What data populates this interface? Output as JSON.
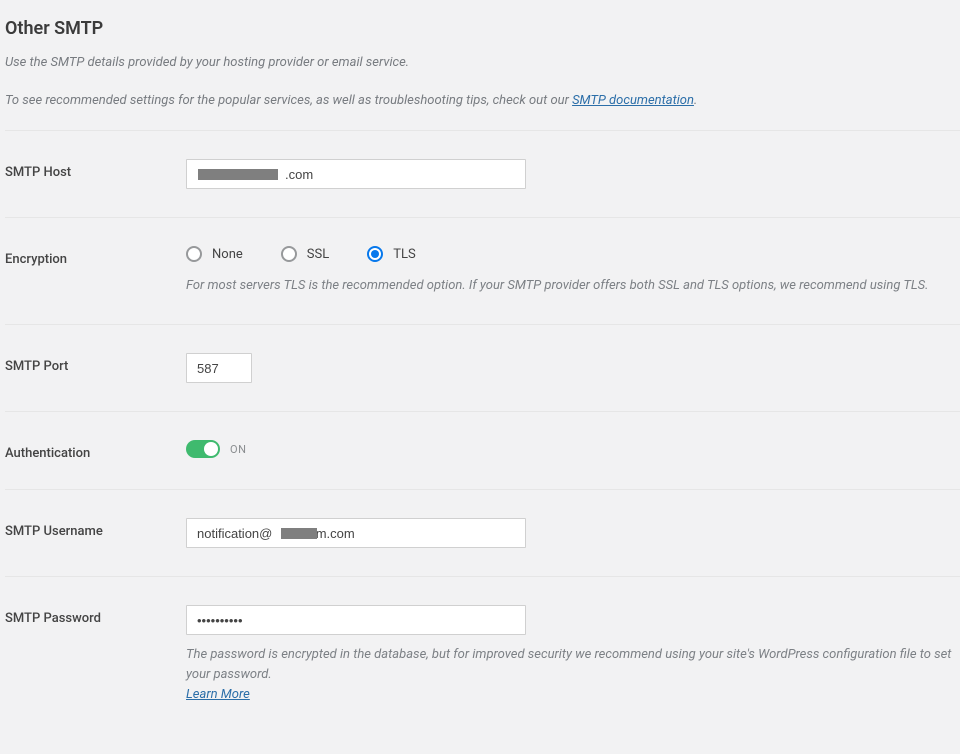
{
  "header": {
    "title": "Other SMTP",
    "desc_line1": "Use the SMTP details provided by your hosting provider or email service.",
    "desc_line2_pre": "To see recommended settings for the popular services, as well as troubleshooting tips, check out our ",
    "desc_link": "SMTP documentation",
    "desc_line2_post": "."
  },
  "fields": {
    "smtp_host": {
      "label": "SMTP Host",
      "value_visible_suffix": ".com"
    },
    "encryption": {
      "label": "Encryption",
      "options": {
        "none": "None",
        "ssl": "SSL",
        "tls": "TLS"
      },
      "selected": "tls",
      "help": "For most servers TLS is the recommended option. If your SMTP provider offers both SSL and TLS options, we recommend using TLS."
    },
    "smtp_port": {
      "label": "SMTP Port",
      "value": "587"
    },
    "authentication": {
      "label": "Authentication",
      "state_label": "ON",
      "enabled": true
    },
    "smtp_username": {
      "label": "SMTP Username",
      "value_visible_prefix": "notification@",
      "value_visible_suffix": "m.com"
    },
    "smtp_password": {
      "label": "SMTP Password",
      "masked_value": "••••••••••",
      "help": "The password is encrypted in the database, but for improved security we recommend using your site's WordPress configuration file to set your password.",
      "learn_more": "Learn More"
    }
  }
}
